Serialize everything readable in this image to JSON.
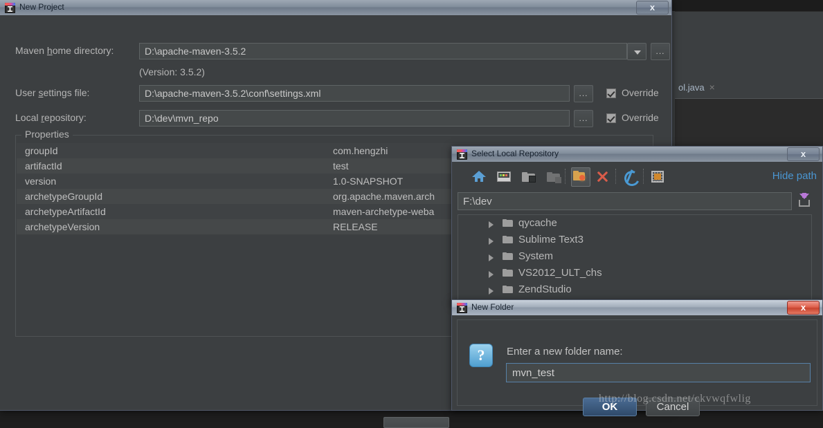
{
  "ide": {
    "tab_label": "ol.java",
    "tab_close": "×",
    "help_icon": "?",
    "save_icon": "save-all-icon"
  },
  "new_project": {
    "title": "New Project",
    "close_label": "x",
    "maven_home_label_pre": "Maven ",
    "maven_home_label_key": "h",
    "maven_home_label_post": "ome directory:",
    "maven_home_value": "D:\\apache-maven-3.5.2",
    "version_text": "(Version: 3.5.2)",
    "user_settings_label_pre": "User ",
    "user_settings_label_key": "s",
    "user_settings_label_post": "ettings file:",
    "user_settings_value": "D:\\apache-maven-3.5.2\\conf\\settings.xml",
    "local_repo_label_pre": "Local ",
    "local_repo_label_key": "r",
    "local_repo_label_post": "epository:",
    "local_repo_value": "D:\\dev\\mvn_repo",
    "browse_label": "...",
    "override_user_settings": "Override",
    "override_local_repo": "Override",
    "override_user_settings_checked": true,
    "override_local_repo_checked": true,
    "properties_legend": "Properties",
    "properties": [
      {
        "key": "groupId",
        "value": "com.hengzhi"
      },
      {
        "key": "artifactId",
        "value": "test"
      },
      {
        "key": "version",
        "value": "1.0-SNAPSHOT"
      },
      {
        "key": "archetypeGroupId",
        "value": "org.apache.maven.arch"
      },
      {
        "key": "archetypeArtifactId",
        "value": "maven-archetype-weba"
      },
      {
        "key": "archetypeVersion",
        "value": "RELEASE"
      }
    ],
    "add_property_icon": "plus-icon"
  },
  "select_repo": {
    "title": "Select Local Repository",
    "close_label": "x",
    "toolbar": [
      {
        "name": "home-icon",
        "label": "Home"
      },
      {
        "name": "desktop-icon",
        "label": "Desktop"
      },
      {
        "name": "folder-down-icon",
        "label": "Collapse"
      },
      {
        "name": "folder-up-icon",
        "label": "Up"
      },
      {
        "name": "new-folder-icon",
        "label": "New Folder"
      },
      {
        "name": "delete-icon",
        "label": "Delete"
      },
      {
        "name": "refresh-icon",
        "label": "Refresh"
      },
      {
        "name": "show-hidden-icon",
        "label": "Show Hidden Files"
      }
    ],
    "hide_path_label": "Hide path",
    "path_value": "F:\\dev",
    "save_path_icon": "save-path-icon",
    "tree_items": [
      "qycache",
      "Sublime Text3",
      "System",
      "VS2012_ULT_chs",
      "ZendStudio"
    ]
  },
  "new_folder": {
    "title": "New Folder",
    "close_label": "x",
    "question_mark": "?",
    "prompt": "Enter a new folder name:",
    "input_value": "mvn_test",
    "ok_label": "OK",
    "cancel_label": "Cancel"
  },
  "watermark": {
    "text": "http://blog.csdn.net/ckvwqfwlig"
  },
  "colors": {
    "panel_bg": "#3c3f41",
    "field_bg": "#45494a",
    "accent_link": "#4a96d2",
    "ok_button": "#3a5c82",
    "add_icon_green": "#4f9a43"
  }
}
